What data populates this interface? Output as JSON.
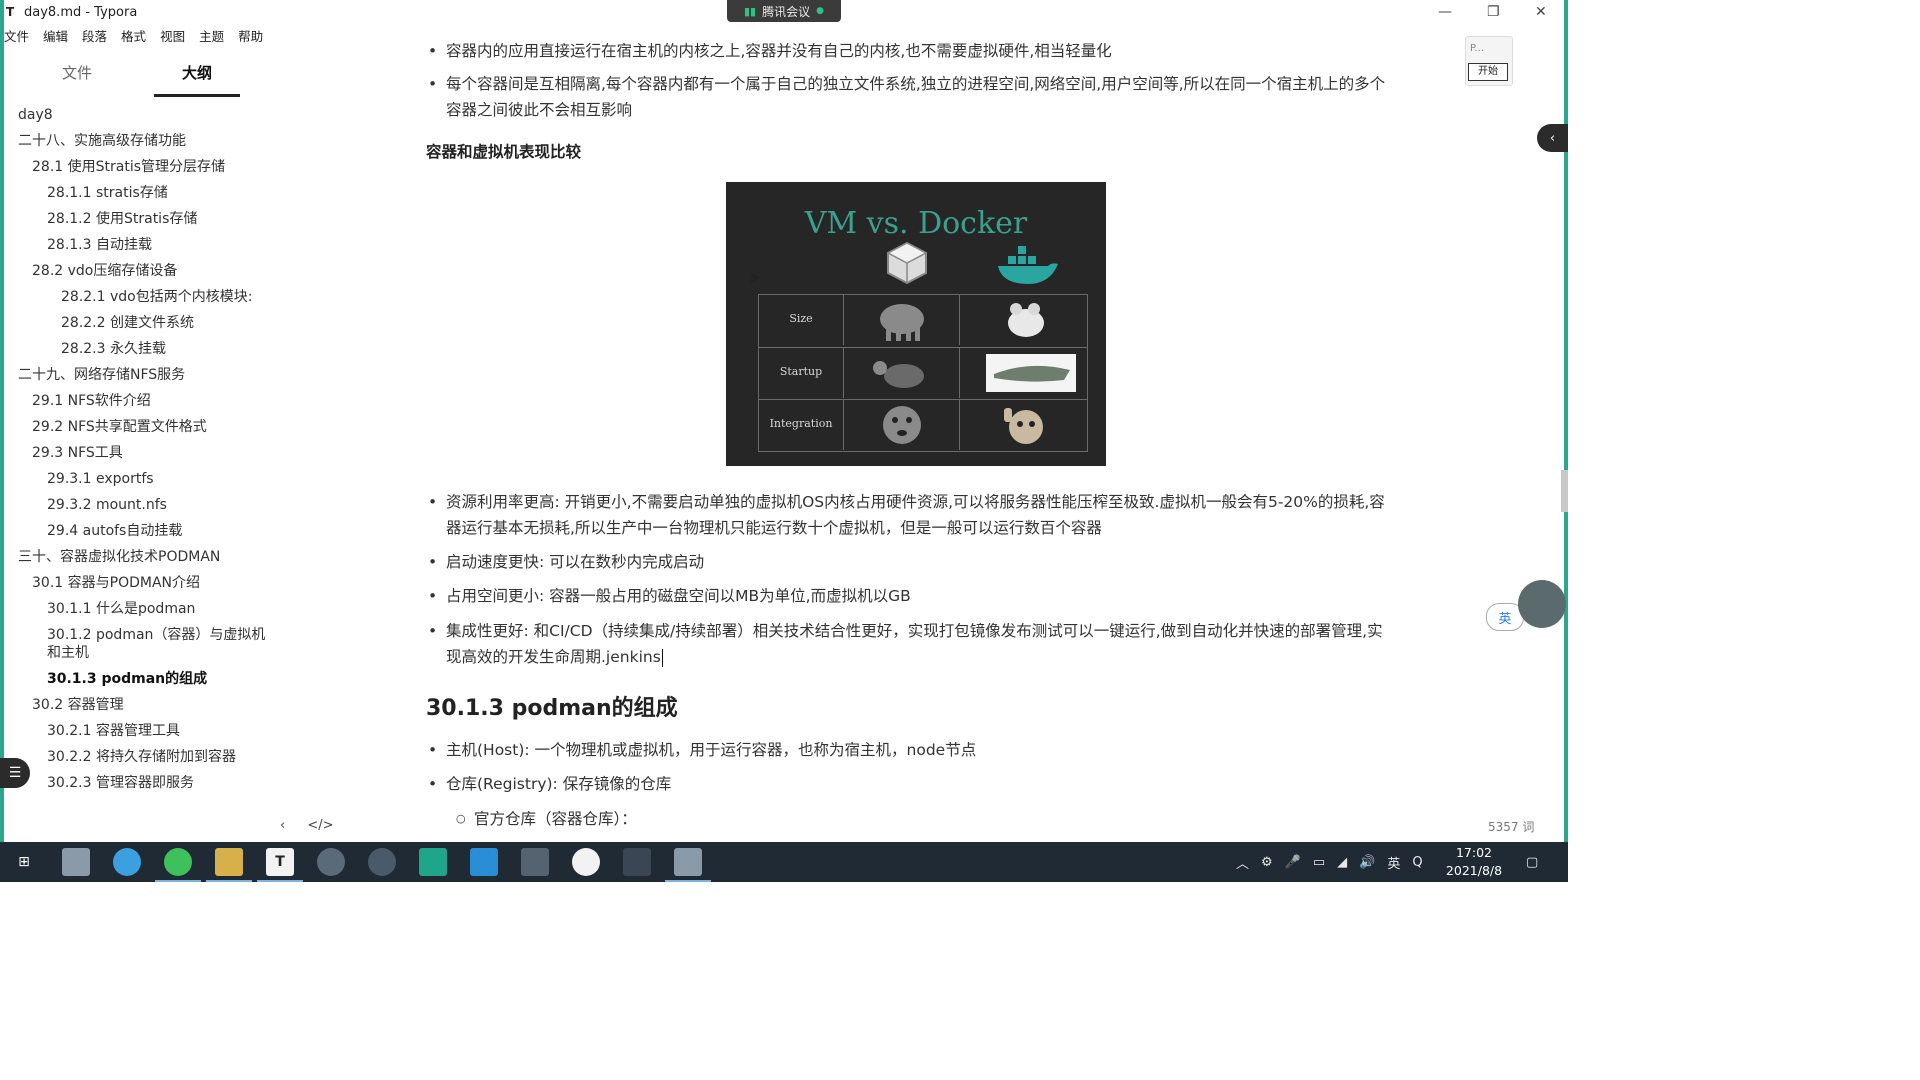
{
  "window": {
    "title": "day8.md - Typora",
    "app_icon": "T",
    "meeting_label": "腾讯会议",
    "controls": [
      "—",
      "❐",
      "✕"
    ]
  },
  "menu": [
    "文件",
    "编辑",
    "段落",
    "格式",
    "视图",
    "主题",
    "帮助"
  ],
  "sidebar": {
    "tabs": [
      {
        "label": "文件",
        "active": false
      },
      {
        "label": "大纲",
        "active": true
      }
    ],
    "outline": [
      "day8",
      "二十八、实施高级存储功能",
      "28.1 使用Stratis管理分层存储",
      "28.1.1 stratis存储",
      "28.1.2 使用Stratis存储",
      "28.1.3 自动挂载",
      "28.2 vdo压缩存储设备",
      "28.2.1 vdo包括两个内核模块:",
      "28.2.2 创建文件系统",
      "28.2.3 永久挂载",
      "二十九、网络存储NFS服务",
      "29.1 NFS软件介绍",
      "29.2 NFS共享配置文件格式",
      "29.3 NFS工具",
      "29.3.1 exportfs",
      "29.3.2 mount.nfs",
      "29.4 autofs自动挂载",
      "三十、容器虚拟化技术PODMAN",
      "30.1 容器与PODMAN介绍",
      "30.1.1 什么是podman",
      "30.1.2 podman（容器）与虚拟机和主机",
      "30.1.3 podman的组成",
      "30.2 容器管理",
      "30.2.1 容器管理工具",
      "30.2.2 将持久存储附加到容器",
      "30.2.3 管理容器即服务"
    ],
    "footer_left": "‹",
    "footer_code": "</>"
  },
  "content": {
    "bullet1": "容器内的应用直接运行在宿主机的内核之上,容器并没有自己的内核,也不需要虚拟硬件,相当轻量化",
    "bullet2": "每个容器间是互相隔离,每个容器内都有一个属于自己的独立文件系统,独立的进程空间,网络空间,用户空间等,所以在同一个宿主机上的多个容器之间彼此不会相互影响",
    "heading_compare": "容器和虚拟机表现比较",
    "figure": {
      "title": "VM vs. Docker",
      "rows": [
        "Size",
        "Startup",
        "Integration"
      ]
    },
    "bullet3": "资源利用率更高: 开销更小,不需要启动单独的虚拟机OS内核占用硬件资源,可以将服务器性能压榨至极致.虚拟机一般会有5-20%的损耗,容器运行基本无损耗,所以生产中一台物理机只能运行数十个虚拟机，但是一般可以运行数百个容器",
    "bullet4": "启动速度更快: 可以在数秒内完成启动",
    "bullet5": "占用空间更小: 容器一般占用的磁盘空间以MB为单位,而虚拟机以GB",
    "bullet6": "集成性更好: 和CI/CD（持续集成/持续部署）相关技术结合性更好，实现打包镜像发布测试可以一键运行,做到自动化并快速的部署管理,实现高效的开发生命周期.jenkins",
    "heading_main": "30.1.3 podman的组成",
    "bullet7": "主机(Host): 一个物理机或虚拟机，用于运行容器，也称为宿主机，node节点",
    "bullet8": "仓库(Registry): 保存镜像的仓库",
    "sub1": "官方仓库（容器仓库）："
  },
  "widgets": {
    "p_label": "P...",
    "start_label": "开始",
    "ime": "英",
    "word_count": "5357 词"
  },
  "taskbar": {
    "time": "17:02",
    "date": "2021/8/8",
    "ime": "英",
    "typora_letter": "T"
  },
  "colors": {
    "accent": "#2aa889",
    "taskbar": "#1f2a35",
    "figure_title": "#3ba08e"
  }
}
